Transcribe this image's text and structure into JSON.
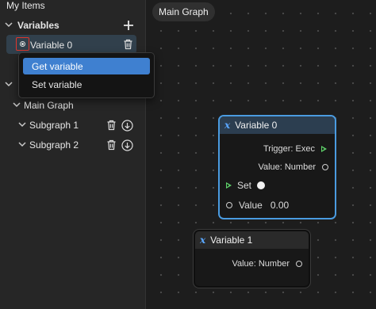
{
  "sidebar": {
    "title": "My Items",
    "variables_section": {
      "label": "Variables",
      "add_icon": "plus-icon"
    },
    "variable_item": {
      "label": "Variable 0",
      "icon": "radio-icon",
      "delete_icon": "trash-icon"
    },
    "context_menu": {
      "items": [
        {
          "label": "Get variable",
          "active": true
        },
        {
          "label": "Set variable",
          "active": false
        }
      ]
    },
    "graphs": {
      "main": {
        "label": "Main Graph"
      },
      "subgraphs": [
        {
          "label": "Subgraph 1"
        },
        {
          "label": "Subgraph 2"
        }
      ]
    }
  },
  "canvas": {
    "tab": {
      "label": "Main Graph"
    },
    "nodes": [
      {
        "title": "Variable 0",
        "selected": true,
        "outputs": [
          {
            "label": "Trigger: Exec",
            "type": "exec"
          },
          {
            "label": "Value: Number",
            "type": "data"
          }
        ],
        "inputs": [
          {
            "label": "Set",
            "type": "exec"
          },
          {
            "label": "Value",
            "type": "data",
            "value": "0.00"
          }
        ]
      },
      {
        "title": "Variable 1",
        "selected": false,
        "outputs": [
          {
            "label": "Value: Number",
            "type": "data"
          }
        ]
      }
    ]
  },
  "colors": {
    "accent": "#3f80d0",
    "selection": "#4a9be0",
    "exec_port": "#5fd36a",
    "highlight_box": "#e0362c"
  }
}
